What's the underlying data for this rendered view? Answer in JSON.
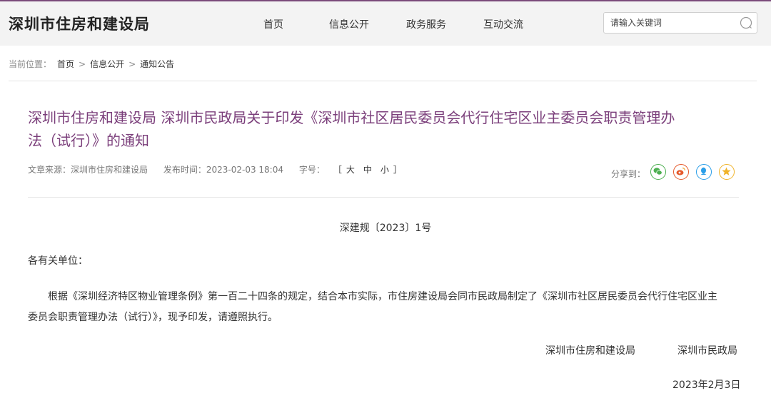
{
  "header": {
    "site_title": "深圳市住房和建设局",
    "nav": [
      "首页",
      "信息公开",
      "政务服务",
      "互动交流"
    ],
    "search_placeholder": "请输入关键词",
    "accent_color": "#7b3f7b"
  },
  "breadcrumb": {
    "label": "当前位置：",
    "items": [
      "首页",
      "信息公开",
      "通知公告"
    ],
    "separator": ">"
  },
  "article": {
    "title_line1": "深圳市住房和建设局 深圳市民政局关于印发《深圳市社区居民委员会代行住宅区业主委员会职责管理办",
    "title_line2": "法（试行）》的通知",
    "source": "文章来源：深圳市住房和建设局",
    "published": "发布时间：2023-02-03 18:04",
    "font_size_label": "字号：",
    "font_size_open": "［",
    "font_size_options": [
      "大",
      "中",
      "小"
    ],
    "font_size_close": "］",
    "share_label": "分享到：",
    "share_icons": [
      "wechat-icon",
      "weibo-icon",
      "qq-icon",
      "qzone-icon"
    ],
    "doc_number": "深建规〔2023〕1号",
    "salutation": "各有关单位：",
    "body_line1": "根据《深圳经济特区物业管理条例》第一百二十四条的规定，结合本市实际，市住房建设局会同市民政局制定了《深圳市社区居民委员会代行住宅区业主",
    "body_line2": "委员会职责管理办法（试行）》，现予印发，请遵照执行。",
    "signatures": [
      "深圳市住房和建设局",
      "深圳市民政局"
    ],
    "date": "2023年2月3日"
  }
}
